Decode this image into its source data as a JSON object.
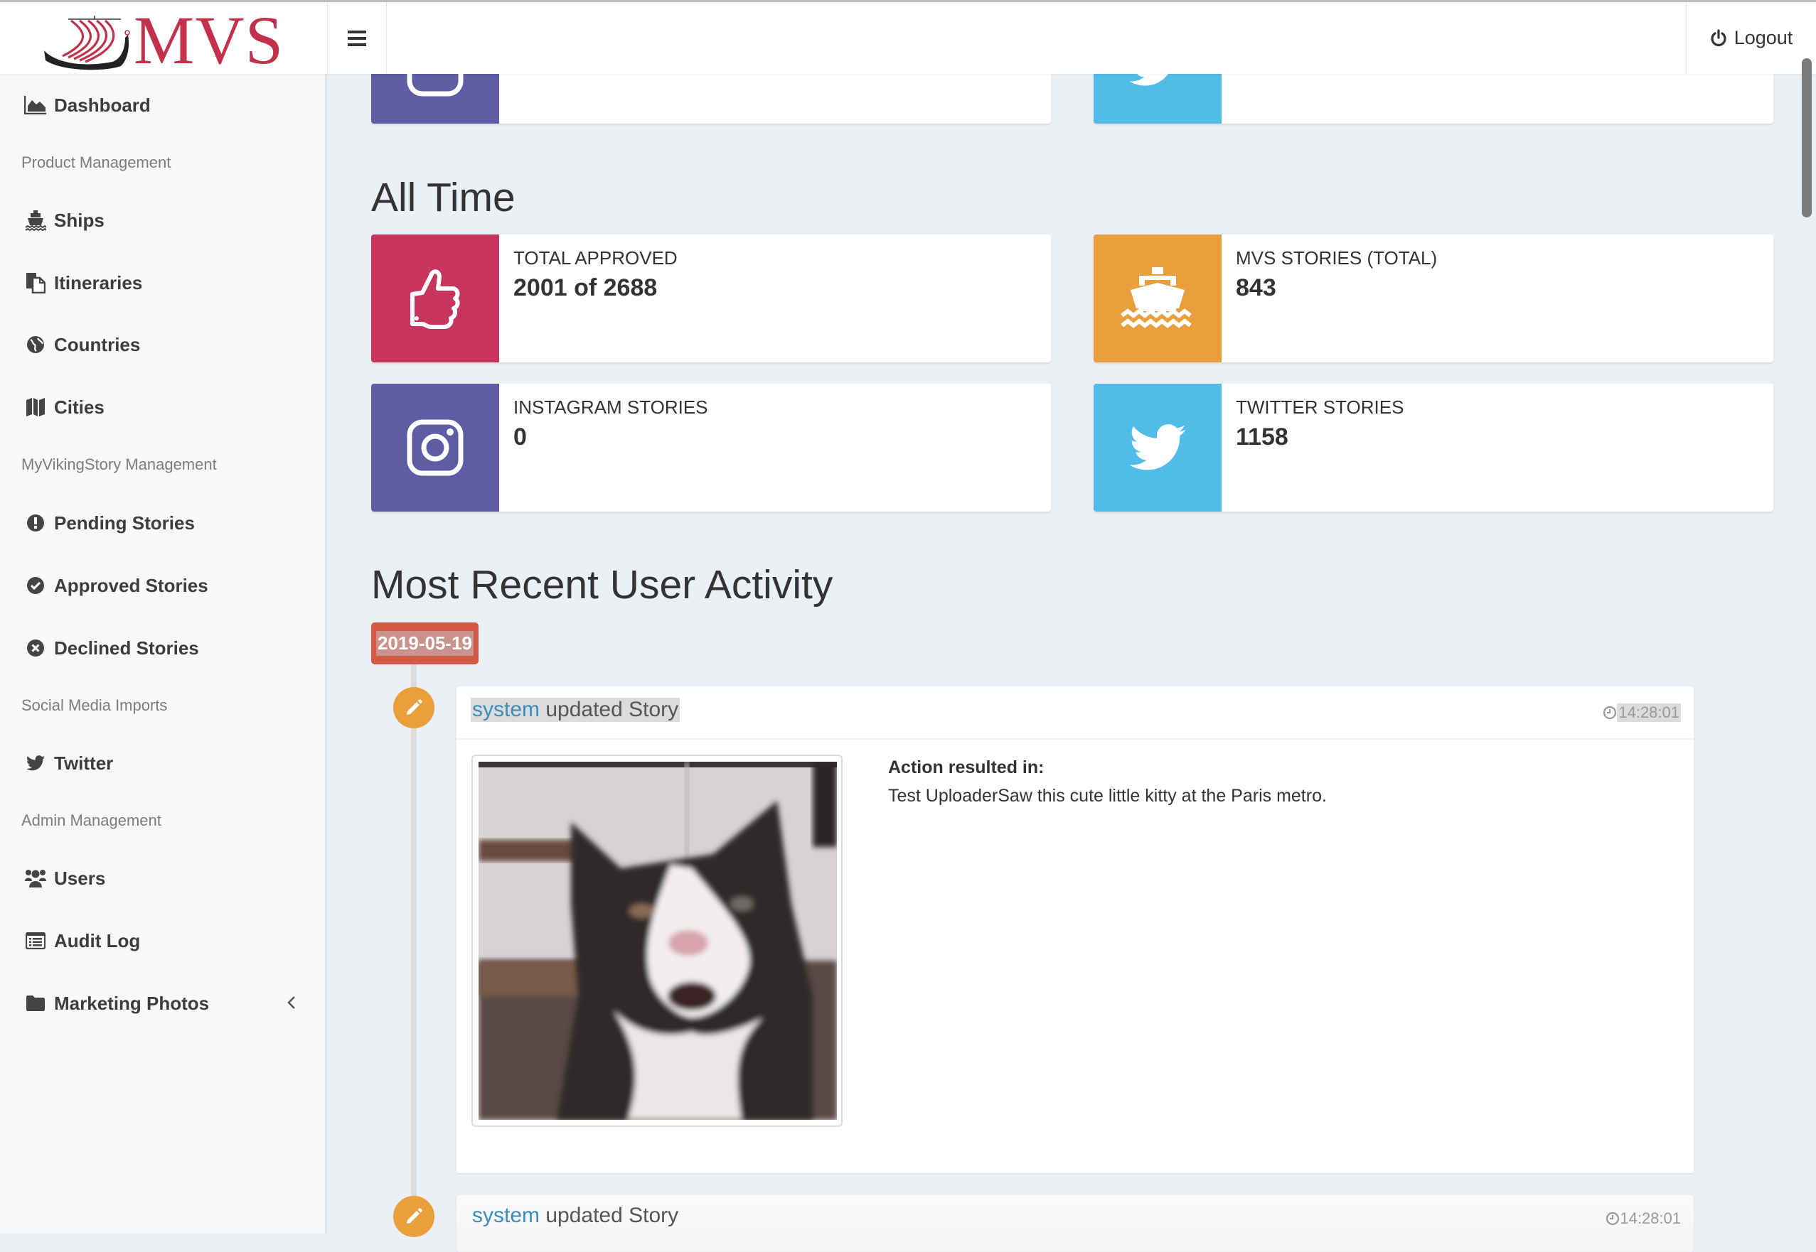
{
  "header": {
    "logo_text": "MVS",
    "menu_toggle_icon": "hamburger-icon",
    "logout_label": "Logout",
    "logout_icon": "power-icon"
  },
  "sidebar": {
    "items": [
      {
        "type": "link",
        "label": "Dashboard",
        "icon": "area-chart-icon"
      },
      {
        "type": "heading",
        "label": "Product Management"
      },
      {
        "type": "link",
        "label": "Ships",
        "icon": "ship-icon"
      },
      {
        "type": "link",
        "label": "Itineraries",
        "icon": "copy-files-icon"
      },
      {
        "type": "link",
        "label": "Countries",
        "icon": "globe-icon"
      },
      {
        "type": "link",
        "label": "Cities",
        "icon": "map-icon"
      },
      {
        "type": "heading",
        "label": "MyVikingStory Management"
      },
      {
        "type": "link",
        "label": "Pending Stories",
        "icon": "exclamation-circle-icon"
      },
      {
        "type": "link",
        "label": "Approved Stories",
        "icon": "check-circle-icon"
      },
      {
        "type": "link",
        "label": "Declined Stories",
        "icon": "times-circle-icon"
      },
      {
        "type": "heading",
        "label": "Social Media Imports"
      },
      {
        "type": "link",
        "label": "Twitter",
        "icon": "twitter-icon"
      },
      {
        "type": "heading",
        "label": "Admin Management"
      },
      {
        "type": "link",
        "label": "Users",
        "icon": "users-icon"
      },
      {
        "type": "link",
        "label": "Audit Log",
        "icon": "list-alt-icon"
      },
      {
        "type": "link",
        "label": "Marketing Photos",
        "icon": "folder-icon",
        "expandable": true
      }
    ]
  },
  "main": {
    "all_time": {
      "title": "All Time",
      "stats": [
        {
          "label": "TOTAL APPROVED",
          "value": "2001 of 2688",
          "icon": "thumbs-up-icon",
          "color": "#c7345e"
        },
        {
          "label": "MVS STORIES (TOTAL)",
          "value": "843",
          "icon": "ship-icon",
          "color": "#e89f3c"
        },
        {
          "label": "INSTAGRAM STORIES",
          "value": "0",
          "icon": "instagram-icon",
          "color": "#605ca3"
        },
        {
          "label": "TWITTER STORIES",
          "value": "1158",
          "icon": "twitter-icon",
          "color": "#52bce9"
        }
      ]
    },
    "activity": {
      "title": "Most Recent User Activity",
      "date": "2019-05-19",
      "entries": [
        {
          "user": "system",
          "action": "updated Story",
          "time": "14:28:01",
          "icon": "pencil-icon",
          "result_label": "Action resulted in:",
          "result_text": "Test UploaderSaw this cute little kitty at the Paris metro.",
          "image": "cat-photo"
        },
        {
          "user": "system",
          "action": "updated Story",
          "time": "14:28:01",
          "icon": "pencil-icon"
        }
      ]
    }
  }
}
